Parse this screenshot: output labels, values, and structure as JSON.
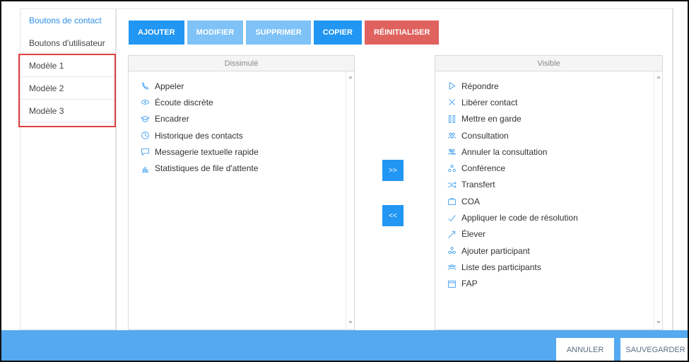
{
  "nav": {
    "items": [
      {
        "label": "Boutons de contact",
        "active": true
      },
      {
        "label": "Boutons d'utilisateur",
        "active": false
      },
      {
        "label": "Modèle 1",
        "active": false
      },
      {
        "label": "Modèle 2",
        "active": false
      },
      {
        "label": "Modèle 3",
        "active": false
      }
    ]
  },
  "toolbar": {
    "add": "AJOUTER",
    "modify": "MODIFIER",
    "delete": "SUPPRIMER",
    "copy": "COPIER",
    "reset": "RÉINITIALISER"
  },
  "hidden_panel": {
    "title": "Dissimulé",
    "items": [
      {
        "label": "Appeler",
        "icon": "phone-icon"
      },
      {
        "label": "Écoute discrète",
        "icon": "eye-icon"
      },
      {
        "label": "Encadrer",
        "icon": "graduation-cap-icon"
      },
      {
        "label": "Historique des contacts",
        "icon": "clock-icon"
      },
      {
        "label": "Messagerie textuelle rapide",
        "icon": "chat-icon"
      },
      {
        "label": "Statistiques de file d'attente",
        "icon": "bar-chart-icon"
      }
    ]
  },
  "visible_panel": {
    "title": "Visible",
    "items": [
      {
        "label": "Répondre",
        "icon": "play-icon"
      },
      {
        "label": "Libérer contact",
        "icon": "close-icon"
      },
      {
        "label": "Mettre en garde",
        "icon": "pause-icon"
      },
      {
        "label": "Consultation",
        "icon": "users-icon"
      },
      {
        "label": "Annuler la consultation",
        "icon": "users-cancel-icon"
      },
      {
        "label": "Conférence",
        "icon": "conference-icon"
      },
      {
        "label": "Transfert",
        "icon": "transfer-icon"
      },
      {
        "label": "COA",
        "icon": "briefcase-icon"
      },
      {
        "label": "Appliquer le code de résolution",
        "icon": "check-icon"
      },
      {
        "label": "Élever",
        "icon": "escalate-icon"
      },
      {
        "label": "Ajouter participant",
        "icon": "add-participant-icon"
      },
      {
        "label": "Liste des participants",
        "icon": "participants-list-icon"
      },
      {
        "label": "FAP",
        "icon": "calendar-icon"
      }
    ]
  },
  "move": {
    "right": ">>",
    "left": "<<"
  },
  "footer": {
    "cancel": "ANNULER",
    "save": "SAUVEGARDER"
  },
  "colors": {
    "accent": "#2196f3",
    "accent_disabled": "#7ec2f7",
    "danger": "#e0625f",
    "footer": "#54a9f0",
    "highlight": "#e0403e",
    "icon": "#4aa3f0"
  }
}
